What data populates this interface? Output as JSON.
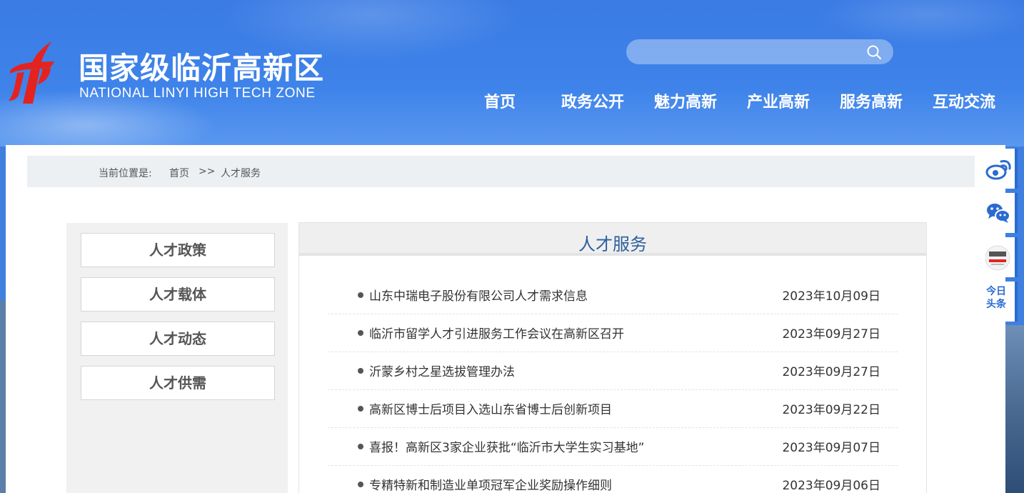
{
  "header": {
    "title": "国家级临沂高新区",
    "subtitle": "NATIONAL LINYI HIGH TECH ZONE",
    "search": {
      "placeholder": "",
      "value": ""
    }
  },
  "nav": [
    {
      "label": "首页"
    },
    {
      "label": "政务公开"
    },
    {
      "label": "魅力高新"
    },
    {
      "label": "产业高新"
    },
    {
      "label": "服务高新"
    },
    {
      "label": "互动交流"
    }
  ],
  "breadcrumb": {
    "prefix": "当前位置是:",
    "home": "首页",
    "separator": ">>",
    "current": "人才服务"
  },
  "sidebar": [
    {
      "label": "人才政策"
    },
    {
      "label": "人才载体"
    },
    {
      "label": "人才动态"
    },
    {
      "label": "人才供需"
    }
  ],
  "content": {
    "title": "人才服务",
    "items": [
      {
        "title": "山东中瑞电子股份有限公司人才需求信息",
        "date": "2023年10月09日"
      },
      {
        "title": "临沂市留学人才引进服务工作会议在高新区召开",
        "date": "2023年09月27日"
      },
      {
        "title": "沂蒙乡村之星选拔管理办法",
        "date": "2023年09月27日"
      },
      {
        "title": "高新区博士后项目入选山东省博士后创新项目",
        "date": "2023年09月22日"
      },
      {
        "title": "喜报！高新区3家企业获批“临沂市大学生实习基地”",
        "date": "2023年09月07日"
      },
      {
        "title": "专精特新和制造业单项冠军企业奖励操作细则",
        "date": "2023年09月06日"
      }
    ]
  },
  "float_bar": {
    "items": [
      {
        "icon": "weibo-icon"
      },
      {
        "icon": "wechat-icon"
      },
      {
        "icon": "guowuyuan-icon"
      },
      {
        "icon": "toutiao-icon",
        "label_line1": "今日",
        "label_line2": "头条"
      }
    ]
  },
  "colors": {
    "header_blue": "#3e83ea",
    "title_blue": "#2d5f9e",
    "accent_blue": "#2a6bd1",
    "logo_red": "#e4231f"
  }
}
